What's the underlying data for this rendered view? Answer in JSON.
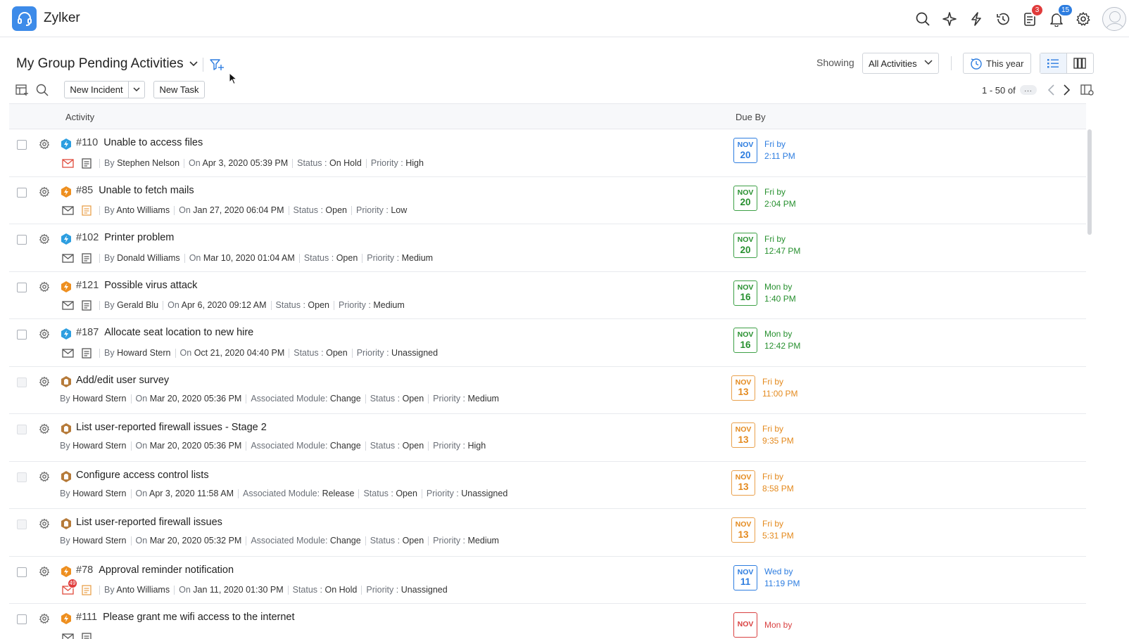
{
  "app": {
    "brand": "Zylker"
  },
  "topbar": {
    "icons": [
      "search-icon",
      "zia-icon",
      "quick-actions-icon",
      "history-icon",
      "tasks-icon",
      "notifications-icon",
      "settings-icon",
      "user-avatar"
    ],
    "tasks_badge": "3",
    "notifications_badge": "15",
    "colors": {
      "brand": "#3d8be9",
      "badge_red": "#e03b3b",
      "badge_blue": "#2d7de0"
    }
  },
  "header": {
    "view_title": "My Group Pending Activities",
    "showing_label": "Showing",
    "activity_filter": "All Activities",
    "date_filter": "This year"
  },
  "toolbar": {
    "new_incident": "New Incident",
    "new_task": "New Task",
    "pager": "1 - 50 of",
    "pager_more": "..."
  },
  "table": {
    "col_activity": "Activity",
    "col_due": "Due By",
    "rows": [
      {
        "type": "incident",
        "kind_color": "blue",
        "number": "#110",
        "title": "Unable to access files",
        "by": "Stephen Nelson",
        "on": "Apr 3, 2020 05:39 PM",
        "status": "On Hold",
        "priority": "High",
        "due_mon": "NOV",
        "due_day": "20",
        "due_weekday": "Fri by",
        "due_time": "2:11 PM",
        "due_color": "blue",
        "mail_color": "red",
        "note_color": "grey"
      },
      {
        "type": "incident",
        "kind_color": "orange",
        "number": "#85",
        "title": "Unable to fetch mails",
        "by": "Anto Williams",
        "on": "Jan 27, 2020 06:04 PM",
        "status": "Open",
        "priority": "Low",
        "due_mon": "NOV",
        "due_day": "20",
        "due_weekday": "Fri by",
        "due_time": "2:04 PM",
        "due_color": "green",
        "mail_color": "grey",
        "note_color": "orange"
      },
      {
        "type": "incident",
        "kind_color": "blue",
        "number": "#102",
        "title": "Printer problem",
        "by": "Donald Williams",
        "on": "Mar 10, 2020 01:04 AM",
        "status": "Open",
        "priority": "Medium",
        "due_mon": "NOV",
        "due_day": "20",
        "due_weekday": "Fri by",
        "due_time": "12:47 PM",
        "due_color": "green",
        "mail_color": "grey",
        "note_color": "grey"
      },
      {
        "type": "incident",
        "kind_color": "orange",
        "number": "#121",
        "title": "Possible virus attack",
        "by": "Gerald Blu",
        "on": "Apr 6, 2020 09:12 AM",
        "status": "Open",
        "priority": "Medium",
        "due_mon": "NOV",
        "due_day": "16",
        "due_weekday": "Mon by",
        "due_time": "1:40 PM",
        "due_color": "green",
        "mail_color": "grey",
        "note_color": "grey"
      },
      {
        "type": "incident",
        "kind_color": "blue",
        "number": "#187",
        "title": "Allocate seat location to new hire",
        "by": "Howard Stern",
        "on": "Oct 21, 2020 04:40 PM",
        "status": "Open",
        "priority": "Unassigned",
        "due_mon": "NOV",
        "due_day": "16",
        "due_weekday": "Mon by",
        "due_time": "12:42 PM",
        "due_color": "green",
        "mail_color": "grey",
        "note_color": "grey"
      },
      {
        "type": "task",
        "title": "Add/edit user survey",
        "by": "Howard Stern",
        "on": "Mar 20, 2020 05:36 PM",
        "module_label": "Associated Module:",
        "module": "Change",
        "status": "Open",
        "priority": "Medium",
        "due_mon": "NOV",
        "due_day": "13",
        "due_weekday": "Fri by",
        "due_time": "11:00 PM",
        "due_color": "orange"
      },
      {
        "type": "task",
        "title": "List user-reported firewall issues - Stage 2",
        "by": "Howard Stern",
        "on": "Mar 20, 2020 05:36 PM",
        "module_label": "Associated Module:",
        "module": "Change",
        "status": "Open",
        "priority": "High",
        "due_mon": "NOV",
        "due_day": "13",
        "due_weekday": "Fri by",
        "due_time": "9:35 PM",
        "due_color": "orange"
      },
      {
        "type": "task",
        "title": "Configure access control lists",
        "by": "Howard Stern",
        "on": "Apr 3, 2020 11:58 AM",
        "module_label": "Associated Module:",
        "module": "Release",
        "status": "Open",
        "priority": "Unassigned",
        "due_mon": "NOV",
        "due_day": "13",
        "due_weekday": "Fri by",
        "due_time": "8:58 PM",
        "due_color": "orange"
      },
      {
        "type": "task",
        "title": "List user-reported firewall issues",
        "by": "Howard Stern",
        "on": "Mar 20, 2020 05:32 PM",
        "module_label": "Associated Module:",
        "module": "Change",
        "status": "Open",
        "priority": "Medium",
        "due_mon": "NOV",
        "due_day": "13",
        "due_weekday": "Fri by",
        "due_time": "5:31 PM",
        "due_color": "orange"
      },
      {
        "type": "incident",
        "kind_color": "orange",
        "number": "#78",
        "title": "Approval reminder notification",
        "by": "Anto Williams",
        "on": "Jan 11, 2020 01:30 PM",
        "status": "On Hold",
        "priority": "Unassigned",
        "due_mon": "NOV",
        "due_day": "11",
        "due_weekday": "Wed by",
        "due_time": "11:19 PM",
        "due_color": "blue",
        "mail_color": "red",
        "mail_badge": "49",
        "note_color": "orange"
      },
      {
        "type": "incident",
        "kind_color": "orange",
        "number": "#111",
        "title": "Please grant me wifi access to the internet",
        "by": "",
        "on": "",
        "status": "",
        "priority": "",
        "due_mon": "NOV",
        "due_day": "",
        "due_weekday": "Mon by",
        "due_time": "",
        "due_color": "red",
        "mail_color": "grey",
        "note_color": "grey"
      }
    ],
    "labels": {
      "by": "By",
      "on": "On",
      "status": "Status :",
      "priority": "Priority :"
    }
  }
}
